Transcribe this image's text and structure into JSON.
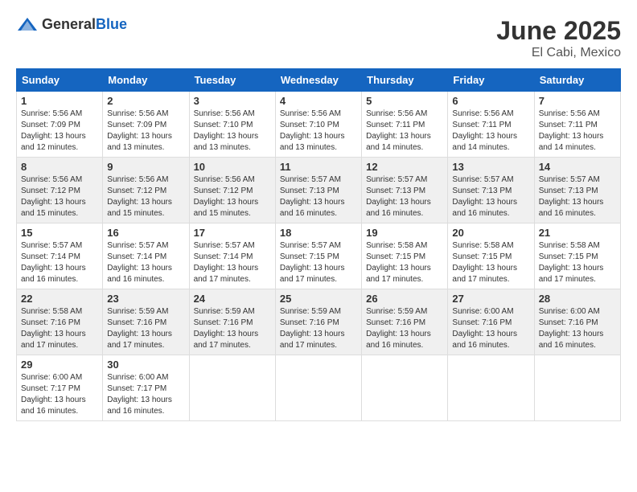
{
  "logo": {
    "general": "General",
    "blue": "Blue"
  },
  "title": "June 2025",
  "location": "El Cabi, Mexico",
  "days_of_week": [
    "Sunday",
    "Monday",
    "Tuesday",
    "Wednesday",
    "Thursday",
    "Friday",
    "Saturday"
  ],
  "weeks": [
    [
      {
        "day": "1",
        "info": "Sunrise: 5:56 AM\nSunset: 7:09 PM\nDaylight: 13 hours\nand 12 minutes."
      },
      {
        "day": "2",
        "info": "Sunrise: 5:56 AM\nSunset: 7:09 PM\nDaylight: 13 hours\nand 13 minutes."
      },
      {
        "day": "3",
        "info": "Sunrise: 5:56 AM\nSunset: 7:10 PM\nDaylight: 13 hours\nand 13 minutes."
      },
      {
        "day": "4",
        "info": "Sunrise: 5:56 AM\nSunset: 7:10 PM\nDaylight: 13 hours\nand 13 minutes."
      },
      {
        "day": "5",
        "info": "Sunrise: 5:56 AM\nSunset: 7:11 PM\nDaylight: 13 hours\nand 14 minutes."
      },
      {
        "day": "6",
        "info": "Sunrise: 5:56 AM\nSunset: 7:11 PM\nDaylight: 13 hours\nand 14 minutes."
      },
      {
        "day": "7",
        "info": "Sunrise: 5:56 AM\nSunset: 7:11 PM\nDaylight: 13 hours\nand 14 minutes."
      }
    ],
    [
      {
        "day": "8",
        "info": "Sunrise: 5:56 AM\nSunset: 7:12 PM\nDaylight: 13 hours\nand 15 minutes."
      },
      {
        "day": "9",
        "info": "Sunrise: 5:56 AM\nSunset: 7:12 PM\nDaylight: 13 hours\nand 15 minutes."
      },
      {
        "day": "10",
        "info": "Sunrise: 5:56 AM\nSunset: 7:12 PM\nDaylight: 13 hours\nand 15 minutes."
      },
      {
        "day": "11",
        "info": "Sunrise: 5:57 AM\nSunset: 7:13 PM\nDaylight: 13 hours\nand 16 minutes."
      },
      {
        "day": "12",
        "info": "Sunrise: 5:57 AM\nSunset: 7:13 PM\nDaylight: 13 hours\nand 16 minutes."
      },
      {
        "day": "13",
        "info": "Sunrise: 5:57 AM\nSunset: 7:13 PM\nDaylight: 13 hours\nand 16 minutes."
      },
      {
        "day": "14",
        "info": "Sunrise: 5:57 AM\nSunset: 7:13 PM\nDaylight: 13 hours\nand 16 minutes."
      }
    ],
    [
      {
        "day": "15",
        "info": "Sunrise: 5:57 AM\nSunset: 7:14 PM\nDaylight: 13 hours\nand 16 minutes."
      },
      {
        "day": "16",
        "info": "Sunrise: 5:57 AM\nSunset: 7:14 PM\nDaylight: 13 hours\nand 16 minutes."
      },
      {
        "day": "17",
        "info": "Sunrise: 5:57 AM\nSunset: 7:14 PM\nDaylight: 13 hours\nand 17 minutes."
      },
      {
        "day": "18",
        "info": "Sunrise: 5:57 AM\nSunset: 7:15 PM\nDaylight: 13 hours\nand 17 minutes."
      },
      {
        "day": "19",
        "info": "Sunrise: 5:58 AM\nSunset: 7:15 PM\nDaylight: 13 hours\nand 17 minutes."
      },
      {
        "day": "20",
        "info": "Sunrise: 5:58 AM\nSunset: 7:15 PM\nDaylight: 13 hours\nand 17 minutes."
      },
      {
        "day": "21",
        "info": "Sunrise: 5:58 AM\nSunset: 7:15 PM\nDaylight: 13 hours\nand 17 minutes."
      }
    ],
    [
      {
        "day": "22",
        "info": "Sunrise: 5:58 AM\nSunset: 7:16 PM\nDaylight: 13 hours\nand 17 minutes."
      },
      {
        "day": "23",
        "info": "Sunrise: 5:59 AM\nSunset: 7:16 PM\nDaylight: 13 hours\nand 17 minutes."
      },
      {
        "day": "24",
        "info": "Sunrise: 5:59 AM\nSunset: 7:16 PM\nDaylight: 13 hours\nand 17 minutes."
      },
      {
        "day": "25",
        "info": "Sunrise: 5:59 AM\nSunset: 7:16 PM\nDaylight: 13 hours\nand 17 minutes."
      },
      {
        "day": "26",
        "info": "Sunrise: 5:59 AM\nSunset: 7:16 PM\nDaylight: 13 hours\nand 16 minutes."
      },
      {
        "day": "27",
        "info": "Sunrise: 6:00 AM\nSunset: 7:16 PM\nDaylight: 13 hours\nand 16 minutes."
      },
      {
        "day": "28",
        "info": "Sunrise: 6:00 AM\nSunset: 7:16 PM\nDaylight: 13 hours\nand 16 minutes."
      }
    ],
    [
      {
        "day": "29",
        "info": "Sunrise: 6:00 AM\nSunset: 7:17 PM\nDaylight: 13 hours\nand 16 minutes."
      },
      {
        "day": "30",
        "info": "Sunrise: 6:00 AM\nSunset: 7:17 PM\nDaylight: 13 hours\nand 16 minutes."
      },
      {
        "day": "",
        "info": ""
      },
      {
        "day": "",
        "info": ""
      },
      {
        "day": "",
        "info": ""
      },
      {
        "day": "",
        "info": ""
      },
      {
        "day": "",
        "info": ""
      }
    ]
  ]
}
